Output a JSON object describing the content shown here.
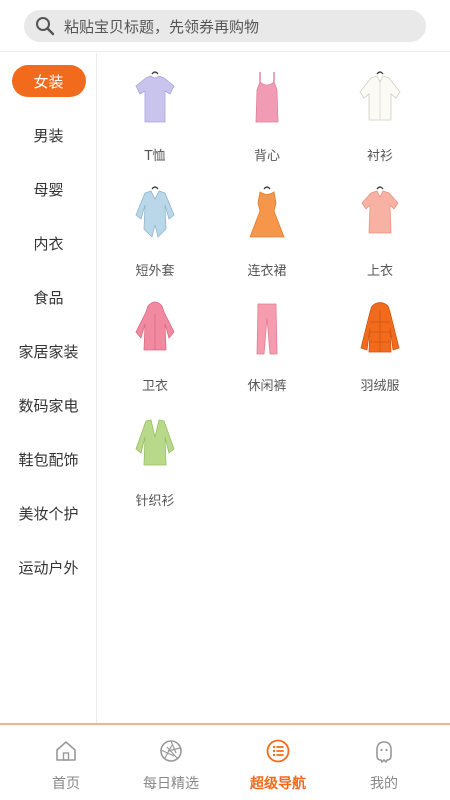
{
  "search": {
    "placeholder": "粘贴宝贝标题，先领券再购物",
    "icon": "search-icon"
  },
  "sidebar": {
    "items": [
      {
        "label": "女装",
        "active": true
      },
      {
        "label": "男装"
      },
      {
        "label": "母婴"
      },
      {
        "label": "内衣"
      },
      {
        "label": "食品"
      },
      {
        "label": "家居家装"
      },
      {
        "label": "数码家电"
      },
      {
        "label": "鞋包配饰"
      },
      {
        "label": "美妆个护"
      },
      {
        "label": "运动户外"
      }
    ]
  },
  "categories": [
    {
      "label": "T恤",
      "icon": "tshirt-icon"
    },
    {
      "label": "背心",
      "icon": "tank-top-icon"
    },
    {
      "label": "衬衫",
      "icon": "shirt-icon"
    },
    {
      "label": "短外套",
      "icon": "short-jacket-icon"
    },
    {
      "label": "连衣裙",
      "icon": "dress-icon"
    },
    {
      "label": "上衣",
      "icon": "blouse-icon"
    },
    {
      "label": "卫衣",
      "icon": "hoodie-icon"
    },
    {
      "label": "休闲裤",
      "icon": "pants-icon"
    },
    {
      "label": "羽绒服",
      "icon": "down-jacket-icon"
    },
    {
      "label": "针织衫",
      "icon": "cardigan-icon"
    }
  ],
  "tabbar": {
    "items": [
      {
        "label": "首页",
        "icon": "home-icon"
      },
      {
        "label": "每日精选",
        "icon": "aperture-icon"
      },
      {
        "label": "超级导航",
        "icon": "list-icon",
        "active": true
      },
      {
        "label": "我的",
        "icon": "profile-icon"
      }
    ]
  },
  "colors": {
    "accent": "#f26b1d",
    "inactive_text": "#888888",
    "search_bg": "#e9e9e9"
  }
}
